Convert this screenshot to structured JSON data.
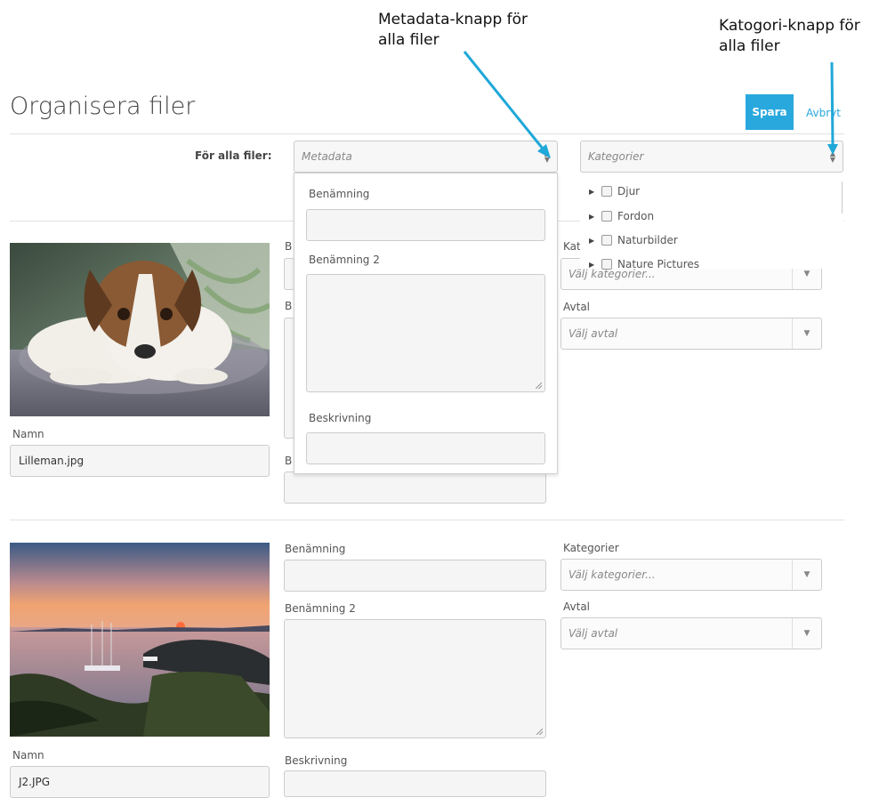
{
  "annotations": {
    "metadata": {
      "line1": "Metadata-knapp för",
      "line2": "alla filer"
    },
    "category": {
      "line1": "Katogori-knapp för",
      "line2": "alla filer"
    }
  },
  "page": {
    "title": "Organisera filer",
    "save_label": "Spara",
    "cancel_label": "Avbryt"
  },
  "for_all": {
    "label": "För alla filer:",
    "metadata_placeholder": "Metadata",
    "categories_placeholder": "Kategorier",
    "metadata_fields": {
      "name": "Benämning",
      "name2": "Benämning 2",
      "description": "Beskrivning"
    },
    "category_tree": [
      "Djur",
      "Fordon",
      "Naturbilder",
      "Nature Pictures"
    ]
  },
  "files": [
    {
      "image": "dog-photo",
      "name_label": "Namn",
      "name_value": "Lilleman.jpg",
      "partial_labels": [
        "B",
        "B",
        "B"
      ],
      "categories_label": "Kat",
      "categories_placeholder": "Välj kategorier...",
      "agreement_label": "Avtal",
      "agreement_placeholder": "Välj avtal"
    },
    {
      "image": "sunset-harbor-photo",
      "name_label": "Namn",
      "name_value": "J2.JPG",
      "label_name": "Benämning",
      "label_name2": "Benämning 2",
      "label_description": "Beskrivning",
      "categories_label": "Kategorier",
      "categories_placeholder": "Välj kategorier...",
      "agreement_label": "Avtal",
      "agreement_placeholder": "Välj avtal"
    }
  ],
  "colors": {
    "accent": "#29a8dd",
    "annotation_arrow": "#1fa8d8"
  }
}
